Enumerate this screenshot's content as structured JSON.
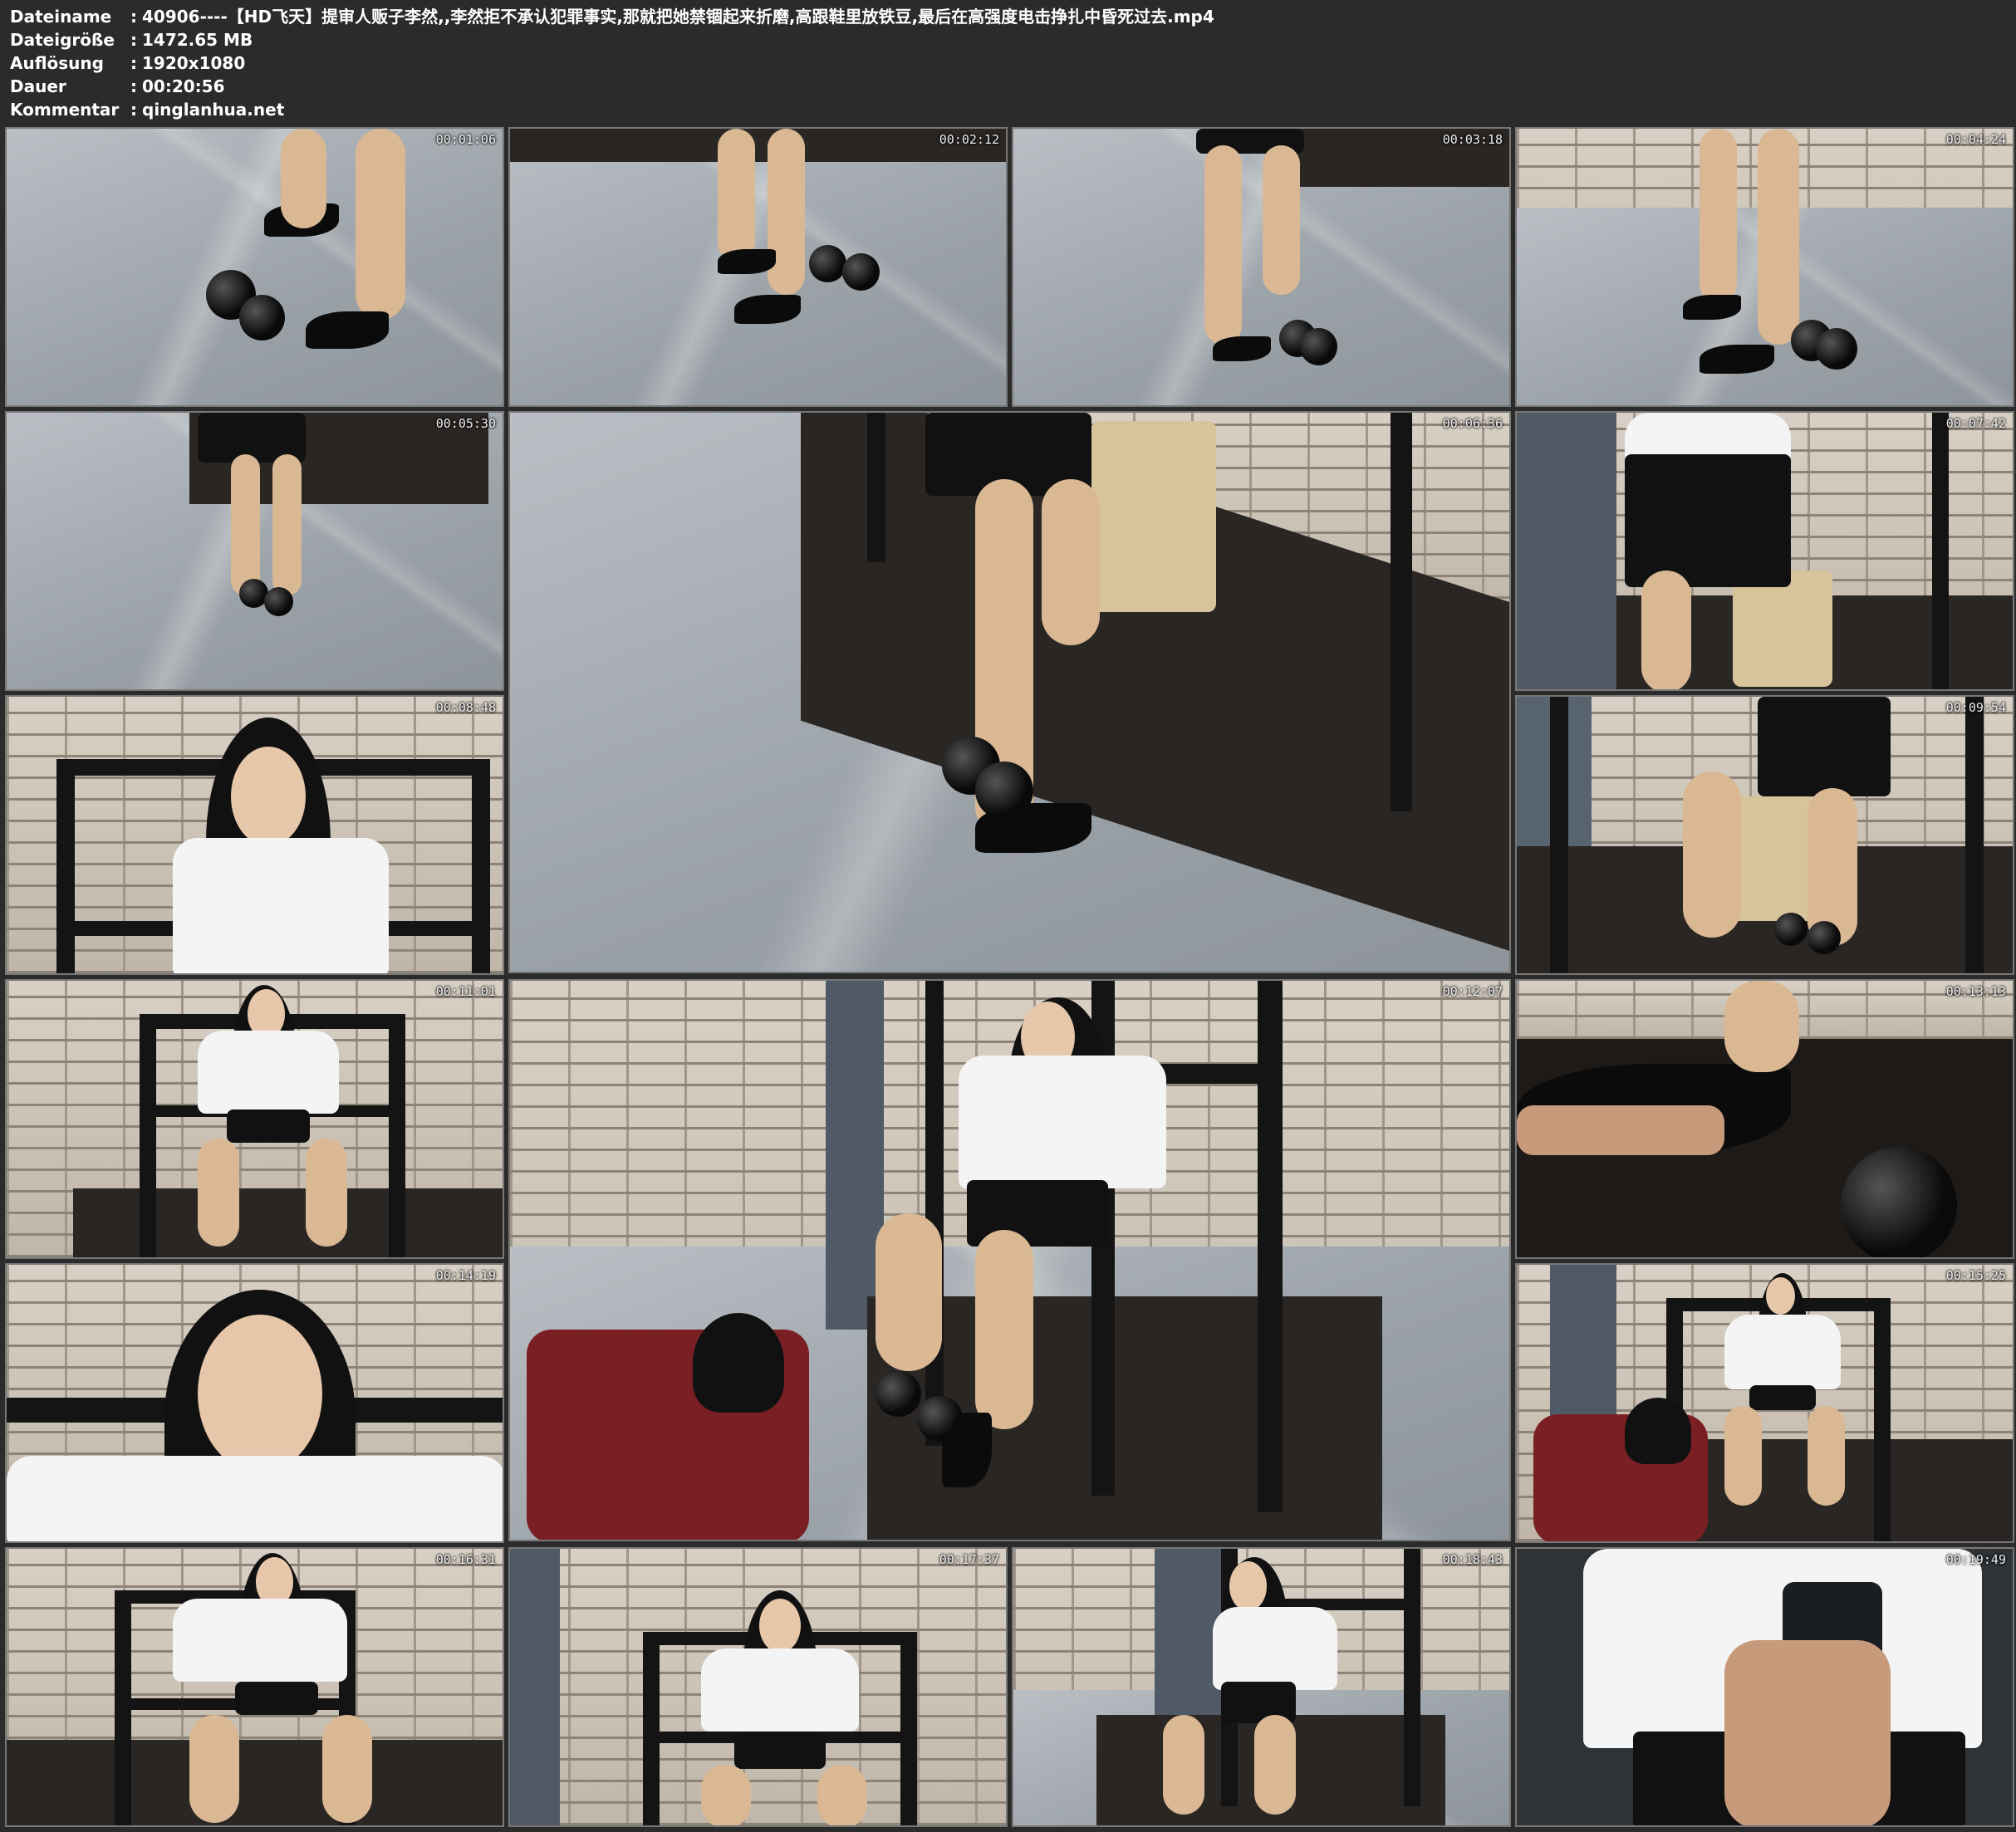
{
  "meta": {
    "rows": [
      {
        "key": "Dateiname",
        "value": "40906----【HD飞天】提审人贩子李然,,李然拒不承认犯罪事实,那就把她禁锢起来折磨,高跟鞋里放铁豆,最后在高强度电击挣扎中昏死过去.mp4"
      },
      {
        "key": "Dateigröße",
        "value": "1472.65 MB"
      },
      {
        "key": "Auflösung",
        "value": "1920x1080"
      },
      {
        "key": "Dauer",
        "value": "00:20:56"
      },
      {
        "key": "Kommentar",
        "value": "qinglanhua.net"
      }
    ],
    "separator": ":"
  },
  "thumbnails": [
    {
      "timestamp": "00:01:06",
      "scene": "floor-feet"
    },
    {
      "timestamp": "00:02:12",
      "scene": "floor-feet"
    },
    {
      "timestamp": "00:03:18",
      "scene": "floor-feet"
    },
    {
      "timestamp": "00:04:24",
      "scene": "wall-feet"
    },
    {
      "timestamp": "00:05:30",
      "scene": "floor-feet"
    },
    {
      "timestamp": "00:06:36",
      "scene": "platform-large"
    },
    {
      "timestamp": "00:07:42",
      "scene": "seated-back"
    },
    {
      "timestamp": "00:08:48",
      "scene": "portrait-frame"
    },
    {
      "timestamp": "00:09:54",
      "scene": "seated-stool"
    },
    {
      "timestamp": "00:11:01",
      "scene": "frame-seated"
    },
    {
      "timestamp": "00:12:07",
      "scene": "frame-large"
    },
    {
      "timestamp": "00:13:13",
      "scene": "shoe-closeup"
    },
    {
      "timestamp": "00:14:19",
      "scene": "face-closeup"
    },
    {
      "timestamp": "00:15:25",
      "scene": "frame-seated-man"
    },
    {
      "timestamp": "00:16:31",
      "scene": "frame-seated"
    },
    {
      "timestamp": "00:17:37",
      "scene": "frame-seated"
    },
    {
      "timestamp": "00:18:43",
      "scene": "frame-side"
    },
    {
      "timestamp": "00:19:49",
      "scene": "phone-closeup"
    }
  ]
}
